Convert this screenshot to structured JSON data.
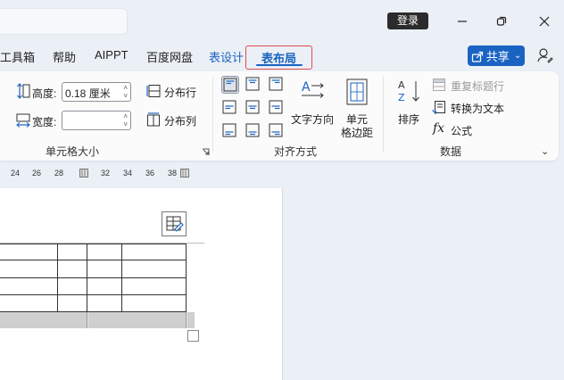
{
  "titlebar": {
    "login_label": "登录"
  },
  "tabs": [
    {
      "label": "工具箱"
    },
    {
      "label": "帮助"
    },
    {
      "label": "AIPPT"
    },
    {
      "label": "百度网盘"
    },
    {
      "label": "表设计"
    }
  ],
  "active_tab": {
    "label": "表布局"
  },
  "share": {
    "label": "共享"
  },
  "ribbon": {
    "cell_size": {
      "height_label": "高度:",
      "height_value": "0.18 厘米",
      "width_label": "宽度:",
      "width_value": "",
      "distribute_rows": "分布行",
      "distribute_cols": "分布列",
      "group_title": "单元格大小"
    },
    "alignment": {
      "text_direction": "文字方向",
      "cell_margin_line1": "单元",
      "cell_margin_line2": "格边距",
      "group_title": "对齐方式"
    },
    "data": {
      "sort": "排序",
      "repeat_header": "重复标题行",
      "convert_to_text": "转换为文本",
      "formula": "公式",
      "group_title": "数据"
    }
  },
  "ruler": {
    "ticks": [
      "24",
      "26",
      "28",
      "32",
      "34",
      "36",
      "38"
    ]
  },
  "colors": {
    "accent": "#1a63c2",
    "active_tab_border": "#e14b4b",
    "background": "#ebeff6"
  }
}
